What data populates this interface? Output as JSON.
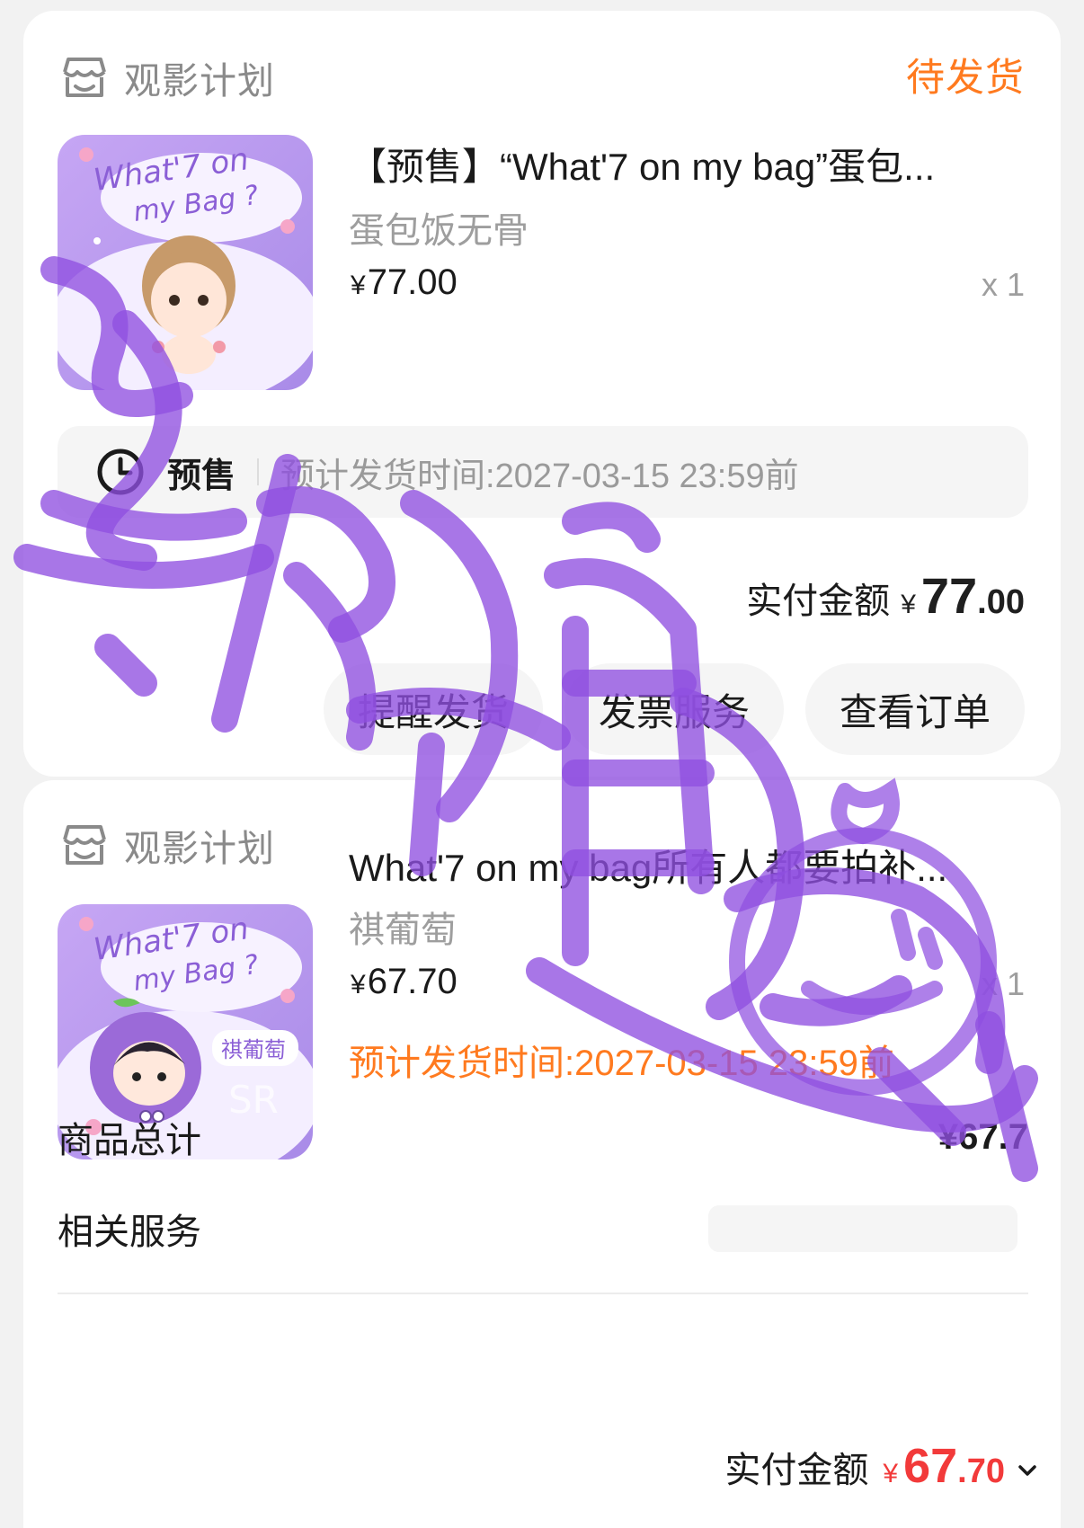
{
  "orders": [
    {
      "store": "观影计划",
      "status": "待发货",
      "thumb": {
        "line1": "What'7 on",
        "line2": "my Bag ?"
      },
      "title": "【预售】“What'7 on my bag”蛋包...",
      "sku": "蛋包饭无骨",
      "price_symbol": "¥",
      "price": "77.00",
      "qty": "x 1",
      "presale_label": "预售",
      "ship_time": "预计发货时间:2027-03-15 23:59前",
      "paid_label": "实付金额",
      "paid_symbol": "¥",
      "paid_int": "77",
      "paid_dec": ".00",
      "buttons": [
        "提醒发货",
        "发票服务",
        "查看订单"
      ]
    },
    {
      "store": "观影计划",
      "thumb": {
        "line1": "What'7 on",
        "line2": "my Bag ?",
        "badge": "祺葡萄",
        "mark": "SR"
      },
      "title": "What'7 on my bag所有人都要拍补...",
      "sku": "祺葡萄",
      "price_symbol": "¥",
      "price": "67.70",
      "qty": "x 1",
      "ship_time": "预计发货时间:2027-03-15 23:59前",
      "goods_total_label": "商品总计",
      "goods_total": "¥67.7",
      "service_label": "相关服务",
      "paid_label": "实付金额",
      "paid_symbol": "¥",
      "paid_int": "67",
      "paid_dec": ".70"
    }
  ],
  "colors": {
    "accent_orange": "#ff7a1f",
    "price_red": "#f23a3a",
    "scribble_purple": "#8f4fe0"
  },
  "icons": [
    "store-icon",
    "clock-icon",
    "chevron-down-icon"
  ]
}
